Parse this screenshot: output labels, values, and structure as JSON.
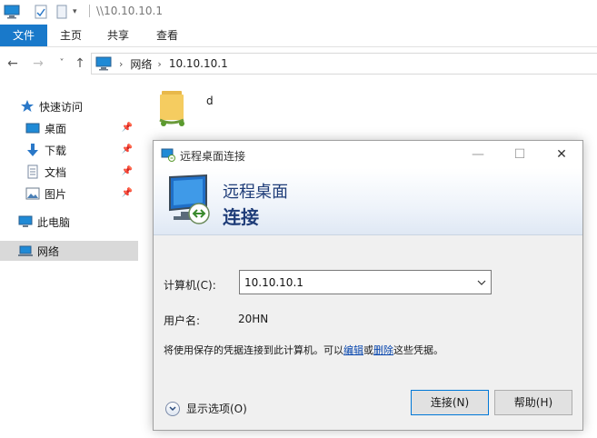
{
  "window": {
    "title_path": "\\\\10.10.10.1"
  },
  "ribbon": {
    "tabs": [
      {
        "label": "文件",
        "active": true
      },
      {
        "label": "主页"
      },
      {
        "label": "共享"
      },
      {
        "label": "查看"
      }
    ]
  },
  "address": {
    "crumbs": [
      "网络",
      "10.10.10.1"
    ]
  },
  "sidebar": {
    "quick_access": "快速访问",
    "items": [
      {
        "label": "桌面",
        "icon": "desktop-icon",
        "pinned": true
      },
      {
        "label": "下载",
        "icon": "download-icon",
        "pinned": true
      },
      {
        "label": "文档",
        "icon": "document-icon",
        "pinned": true
      },
      {
        "label": "图片",
        "icon": "picture-icon",
        "pinned": true
      }
    ],
    "this_pc": "此电脑",
    "network": "网络"
  },
  "content": {
    "folder_name": "d"
  },
  "rdp_dialog": {
    "title": "远程桌面连接",
    "banner_line1": "远程桌面",
    "banner_line2": "连接",
    "computer_label": "计算机(C):",
    "computer_value": "10.10.10.1",
    "username_label": "用户名:",
    "username_value": "20HN",
    "info_prefix": "将使用保存的凭据连接到此计算机。可以",
    "info_edit": "编辑",
    "info_or": "或",
    "info_delete": "删除",
    "info_suffix": "这些凭据。",
    "show_options": "显示选项(O)",
    "connect_button": "连接(N)",
    "help_button": "帮助(H)"
  },
  "colors": {
    "file_tab": "#1979ca",
    "banner_text": "#1e3c78",
    "link": "#0645ad",
    "selected_nav": "#d9d9d9"
  }
}
